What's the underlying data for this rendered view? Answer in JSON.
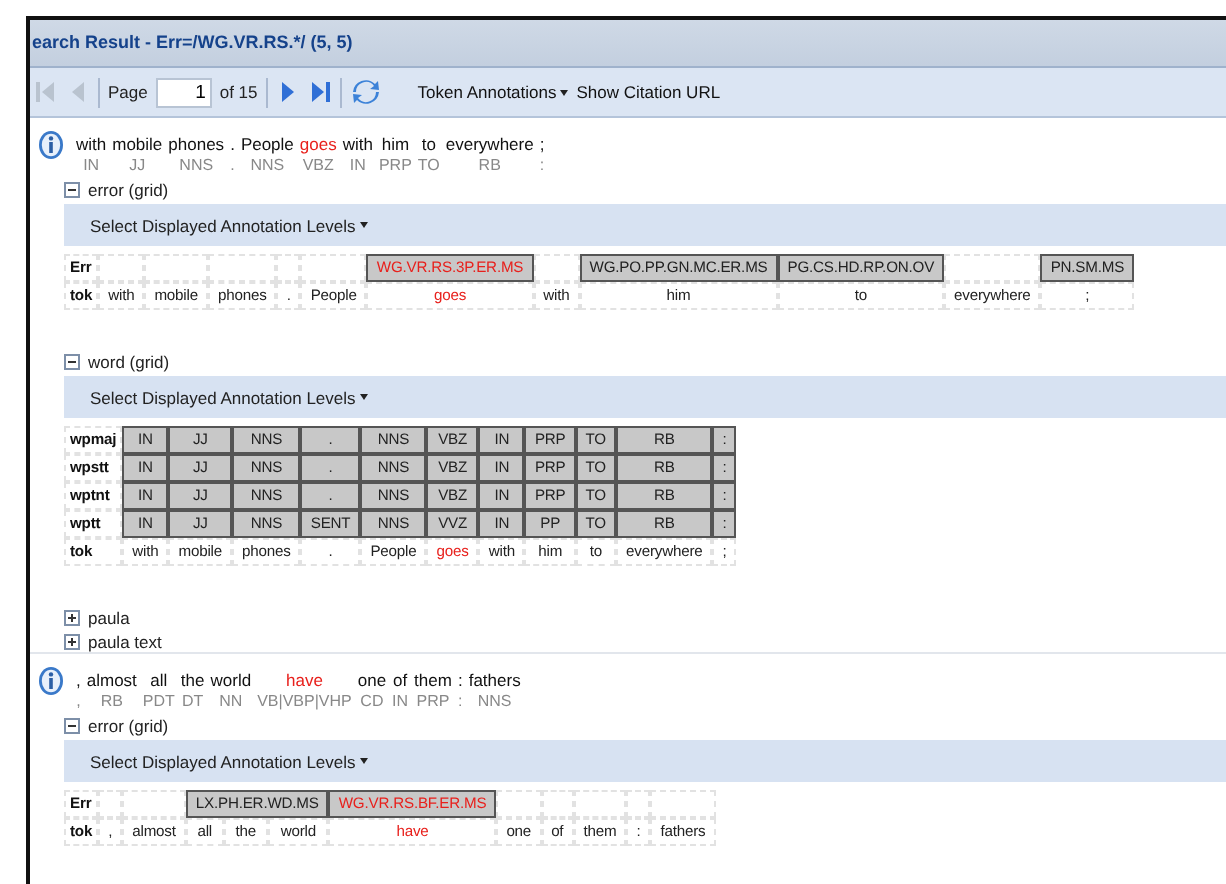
{
  "window": {
    "title": "earch Result - Err=/WG.VR.RS.*/ (5, 5)"
  },
  "toolbar": {
    "items": [
      {
        "kind": "first",
        "disabled": true
      },
      {
        "kind": "prev",
        "disabled": true
      },
      {
        "kind": "page",
        "label": "Page",
        "value": "1",
        "total": "of 15"
      },
      {
        "kind": "next",
        "disabled": false
      },
      {
        "kind": "last",
        "disabled": false
      },
      {
        "kind": "refresh",
        "disabled": false
      },
      {
        "kind": "menu",
        "label": "Token Annotations"
      },
      {
        "kind": "link",
        "label": "Show Citation URL"
      }
    ]
  },
  "results": [
    {
      "tokens": [
        {
          "word": "with",
          "pos": "IN",
          "error": false
        },
        {
          "word": "mobile",
          "pos": "JJ",
          "error": false
        },
        {
          "word": "phones",
          "pos": "NNS",
          "error": false
        },
        {
          "word": ".",
          "pos": ".",
          "error": false
        },
        {
          "word": "People",
          "pos": "NNS",
          "error": false
        },
        {
          "word": "goes",
          "pos": "VBZ",
          "error": true
        },
        {
          "word": "with",
          "pos": "IN",
          "error": false
        },
        {
          "word": "him",
          "pos": "PRP",
          "error": false
        },
        {
          "word": "to",
          "pos": "TO",
          "error": false
        },
        {
          "word": "everywhere",
          "pos": "RB",
          "error": false
        },
        {
          "word": ";",
          "pos": ":",
          "error": false
        }
      ],
      "sections": [
        {
          "title": "error (grid)",
          "expanded": true,
          "levels_button": "Select Displayed Annotation Levels",
          "rows": [
            {
              "label": "Err",
              "cells": [
                {
                  "kind": "empty"
                },
                {
                  "kind": "empty"
                },
                {
                  "kind": "empty"
                },
                {
                  "kind": "empty"
                },
                {
                  "kind": "empty"
                },
                {
                  "kind": "annotation",
                  "text": "WG.VR.RS.3P.ER.MS",
                  "error": true
                },
                {
                  "kind": "empty"
                },
                {
                  "kind": "annotation",
                  "text": "WG.PO.PP.GN.MC.ER.MS",
                  "error": false
                },
                {
                  "kind": "annotation",
                  "text": "PG.CS.HD.RP.ON.OV",
                  "error": false
                },
                {
                  "kind": "empty"
                },
                {
                  "kind": "annotation",
                  "text": "PN.SM.MS",
                  "error": false
                }
              ]
            },
            {
              "label": "tok",
              "cells": [
                {
                  "kind": "token",
                  "text": "with",
                  "error": false
                },
                {
                  "kind": "token",
                  "text": "mobile",
                  "error": false
                },
                {
                  "kind": "token",
                  "text": "phones",
                  "error": false
                },
                {
                  "kind": "token",
                  "text": ".",
                  "error": false
                },
                {
                  "kind": "token",
                  "text": "People",
                  "error": false
                },
                {
                  "kind": "token",
                  "text": "goes",
                  "error": true
                },
                {
                  "kind": "token",
                  "text": "with",
                  "error": false
                },
                {
                  "kind": "token",
                  "text": "him",
                  "error": false
                },
                {
                  "kind": "token",
                  "text": "to",
                  "error": false
                },
                {
                  "kind": "token",
                  "text": "everywhere",
                  "error": false
                },
                {
                  "kind": "token",
                  "text": ";",
                  "error": false
                }
              ]
            }
          ]
        },
        {
          "title": "word (grid)",
          "expanded": true,
          "levels_button": "Select Displayed Annotation Levels",
          "rows": [
            {
              "label": "wpmaj",
              "cells": [
                {
                  "kind": "annotation",
                  "text": "IN",
                  "error": false
                },
                {
                  "kind": "annotation",
                  "text": "JJ",
                  "error": false
                },
                {
                  "kind": "annotation",
                  "text": "NNS",
                  "error": false
                },
                {
                  "kind": "annotation",
                  "text": ".",
                  "error": false
                },
                {
                  "kind": "annotation",
                  "text": "NNS",
                  "error": false
                },
                {
                  "kind": "annotation",
                  "text": "VBZ",
                  "error": false
                },
                {
                  "kind": "annotation",
                  "text": "IN",
                  "error": false
                },
                {
                  "kind": "annotation",
                  "text": "PRP",
                  "error": false
                },
                {
                  "kind": "annotation",
                  "text": "TO",
                  "error": false
                },
                {
                  "kind": "annotation",
                  "text": "RB",
                  "error": false
                },
                {
                  "kind": "annotation",
                  "text": ":",
                  "error": false
                }
              ]
            },
            {
              "label": "wpstt",
              "cells": [
                {
                  "kind": "annotation",
                  "text": "IN",
                  "error": false
                },
                {
                  "kind": "annotation",
                  "text": "JJ",
                  "error": false
                },
                {
                  "kind": "annotation",
                  "text": "NNS",
                  "error": false
                },
                {
                  "kind": "annotation",
                  "text": ".",
                  "error": false
                },
                {
                  "kind": "annotation",
                  "text": "NNS",
                  "error": false
                },
                {
                  "kind": "annotation",
                  "text": "VBZ",
                  "error": false
                },
                {
                  "kind": "annotation",
                  "text": "IN",
                  "error": false
                },
                {
                  "kind": "annotation",
                  "text": "PRP",
                  "error": false
                },
                {
                  "kind": "annotation",
                  "text": "TO",
                  "error": false
                },
                {
                  "kind": "annotation",
                  "text": "RB",
                  "error": false
                },
                {
                  "kind": "annotation",
                  "text": ":",
                  "error": false
                }
              ]
            },
            {
              "label": "wptnt",
              "cells": [
                {
                  "kind": "annotation",
                  "text": "IN",
                  "error": false
                },
                {
                  "kind": "annotation",
                  "text": "JJ",
                  "error": false
                },
                {
                  "kind": "annotation",
                  "text": "NNS",
                  "error": false
                },
                {
                  "kind": "annotation",
                  "text": ".",
                  "error": false
                },
                {
                  "kind": "annotation",
                  "text": "NNS",
                  "error": false
                },
                {
                  "kind": "annotation",
                  "text": "VBZ",
                  "error": false
                },
                {
                  "kind": "annotation",
                  "text": "IN",
                  "error": false
                },
                {
                  "kind": "annotation",
                  "text": "PRP",
                  "error": false
                },
                {
                  "kind": "annotation",
                  "text": "TO",
                  "error": false
                },
                {
                  "kind": "annotation",
                  "text": "RB",
                  "error": false
                },
                {
                  "kind": "annotation",
                  "text": ":",
                  "error": false
                }
              ]
            },
            {
              "label": "wptt",
              "cells": [
                {
                  "kind": "annotation",
                  "text": "IN",
                  "error": false
                },
                {
                  "kind": "annotation",
                  "text": "JJ",
                  "error": false
                },
                {
                  "kind": "annotation",
                  "text": "NNS",
                  "error": false
                },
                {
                  "kind": "annotation",
                  "text": "SENT",
                  "error": false
                },
                {
                  "kind": "annotation",
                  "text": "NNS",
                  "error": false
                },
                {
                  "kind": "annotation",
                  "text": "VVZ",
                  "error": false
                },
                {
                  "kind": "annotation",
                  "text": "IN",
                  "error": false
                },
                {
                  "kind": "annotation",
                  "text": "PP",
                  "error": false
                },
                {
                  "kind": "annotation",
                  "text": "TO",
                  "error": false
                },
                {
                  "kind": "annotation",
                  "text": "RB",
                  "error": false
                },
                {
                  "kind": "annotation",
                  "text": ":",
                  "error": false
                }
              ]
            },
            {
              "label": "tok",
              "cells": [
                {
                  "kind": "token",
                  "text": "with",
                  "error": false
                },
                {
                  "kind": "token",
                  "text": "mobile",
                  "error": false
                },
                {
                  "kind": "token",
                  "text": "phones",
                  "error": false
                },
                {
                  "kind": "token",
                  "text": ".",
                  "error": false
                },
                {
                  "kind": "token",
                  "text": "People",
                  "error": false
                },
                {
                  "kind": "token",
                  "text": "goes",
                  "error": true
                },
                {
                  "kind": "token",
                  "text": "with",
                  "error": false
                },
                {
                  "kind": "token",
                  "text": "him",
                  "error": false
                },
                {
                  "kind": "token",
                  "text": "to",
                  "error": false
                },
                {
                  "kind": "token",
                  "text": "everywhere",
                  "error": false
                },
                {
                  "kind": "token",
                  "text": ";",
                  "error": false
                }
              ]
            }
          ]
        },
        {
          "title": "paula",
          "expanded": false
        },
        {
          "title": "paula text",
          "expanded": false
        }
      ]
    },
    {
      "tokens": [
        {
          "word": ",",
          "pos": ",",
          "error": false
        },
        {
          "word": "almost",
          "pos": "RB",
          "error": false
        },
        {
          "word": "all",
          "pos": "PDT",
          "error": false
        },
        {
          "word": "the",
          "pos": "DT",
          "error": false
        },
        {
          "word": "world",
          "pos": "NN",
          "error": false
        },
        {
          "word": "have",
          "pos": "VB|VBP|VHP",
          "error": true
        },
        {
          "word": "one",
          "pos": "CD",
          "error": false
        },
        {
          "word": "of",
          "pos": "IN",
          "error": false
        },
        {
          "word": "them",
          "pos": "PRP",
          "error": false
        },
        {
          "word": ":",
          "pos": ":",
          "error": false
        },
        {
          "word": "fathers",
          "pos": "NNS",
          "error": false
        }
      ],
      "sections": [
        {
          "title": "error (grid)",
          "expanded": true,
          "levels_button": "Select Displayed Annotation Levels",
          "rows": [
            {
              "label": "Err",
              "cells": [
                {
                  "kind": "empty"
                },
                {
                  "kind": "empty"
                },
                {
                  "kind": "annotation",
                  "text": "LX.PH.ER.WD.MS",
                  "error": false,
                  "colspan": 3
                },
                {
                  "kind": "annotation",
                  "text": "WG.VR.RS.BF.ER.MS",
                  "error": true
                },
                {
                  "kind": "empty"
                },
                {
                  "kind": "empty"
                },
                {
                  "kind": "empty"
                },
                {
                  "kind": "empty"
                },
                {
                  "kind": "empty"
                }
              ]
            },
            {
              "label": "tok",
              "cells": [
                {
                  "kind": "token",
                  "text": ",",
                  "error": false
                },
                {
                  "kind": "token",
                  "text": "almost",
                  "error": false
                },
                {
                  "kind": "token",
                  "text": "all",
                  "error": false
                },
                {
                  "kind": "token",
                  "text": "the",
                  "error": false
                },
                {
                  "kind": "token",
                  "text": "world",
                  "error": false
                },
                {
                  "kind": "token",
                  "text": "have",
                  "error": true
                },
                {
                  "kind": "token",
                  "text": "one",
                  "error": false
                },
                {
                  "kind": "token",
                  "text": "of",
                  "error": false
                },
                {
                  "kind": "token",
                  "text": "them",
                  "error": false
                },
                {
                  "kind": "token",
                  "text": ":",
                  "error": false
                },
                {
                  "kind": "token",
                  "text": "fathers",
                  "error": false
                }
              ]
            }
          ]
        }
      ]
    }
  ]
}
